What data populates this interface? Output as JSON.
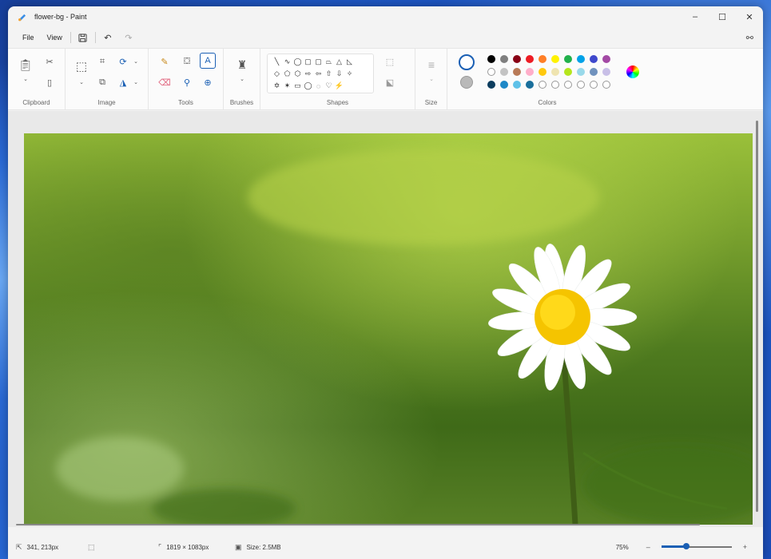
{
  "window": {
    "title": "flower-bg - Paint"
  },
  "window_controls": {
    "minimize": "–",
    "maximize": "☐",
    "close": "✕"
  },
  "menu": {
    "file": "File",
    "view": "View"
  },
  "ribbon": {
    "groups": {
      "clipboard": "Clipboard",
      "image": "Image",
      "tools": "Tools",
      "brushes": "Brushes",
      "shapes": "Shapes",
      "size": "Size",
      "colors": "Colors"
    },
    "active_tool": "text-tool",
    "shape_glyphs": [
      "╲",
      "∿",
      "◯",
      "▢",
      "▢",
      "⏢",
      "△",
      "◺",
      "",
      "◇",
      "⬠",
      "⬡",
      "⇨",
      "⇦",
      "⇧",
      "⇩",
      "✧",
      "",
      "✡",
      "✶",
      "▭",
      "◯",
      "◌",
      "♡",
      "⚡",
      "",
      ""
    ],
    "palette_row1": [
      "#000000",
      "#7f7f7f",
      "#880015",
      "#ed1c24",
      "#ff7f27",
      "#fff200",
      "#22b14c",
      "#00a2e8",
      "#3f48cc",
      "#a349a4"
    ],
    "palette_row2": [
      "#ffffff",
      "#c3c3c3",
      "#b97a57",
      "#ffaec9",
      "#ffc90e",
      "#efe4b0",
      "#b5e61d",
      "#99d9ea",
      "#7092be",
      "#c8bfe7"
    ],
    "palette_row3": [
      "#0c3d5e",
      "#1e88c7",
      "#5fc1e8",
      "#1a6f9c",
      "#ffffff",
      "#ffffff",
      "#ffffff",
      "#ffffff",
      "#ffffff",
      "#ffffff"
    ],
    "primary_color": "#ffffff",
    "secondary_color": "#b9b9b9"
  },
  "status": {
    "cursor": "341, 213px",
    "dimensions": "1819 × 1083px",
    "size": "Size: 2.5MB",
    "zoom": "75%",
    "zoom_level": 0.35
  }
}
